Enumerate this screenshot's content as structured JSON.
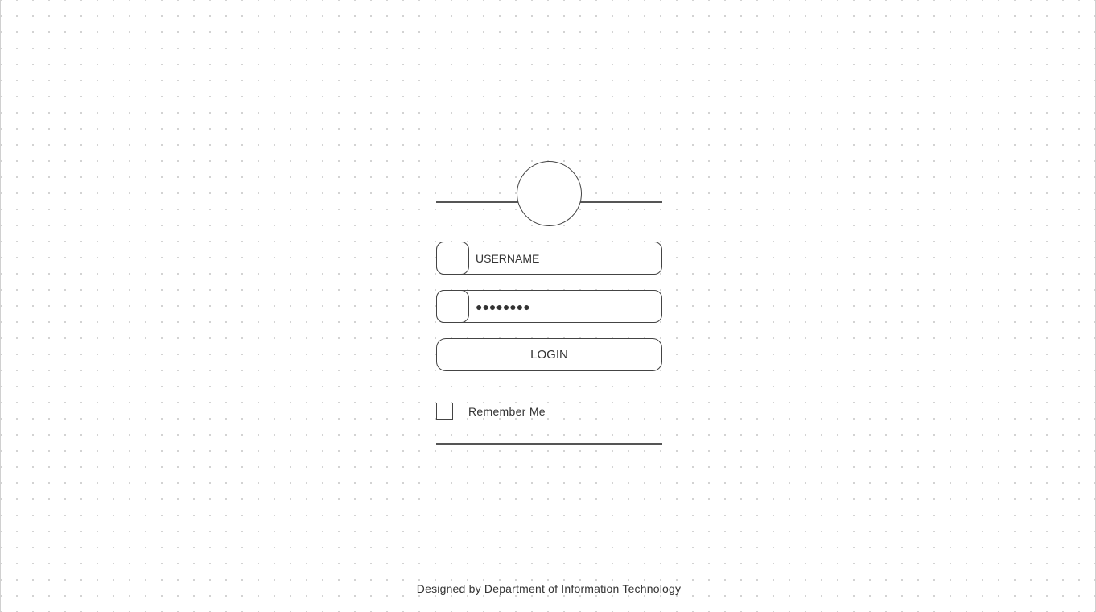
{
  "login_form": {
    "username": {
      "placeholder": "USERNAME",
      "value": "",
      "icon": "user-icon"
    },
    "password": {
      "value": "●●●●●●●●",
      "icon": "lock-icon"
    },
    "login_label": "LOGIN",
    "remember_me_label": "Remember Me",
    "remember_me_checked": false
  },
  "footer": {
    "text": "Designed by Department of Information Technology"
  }
}
